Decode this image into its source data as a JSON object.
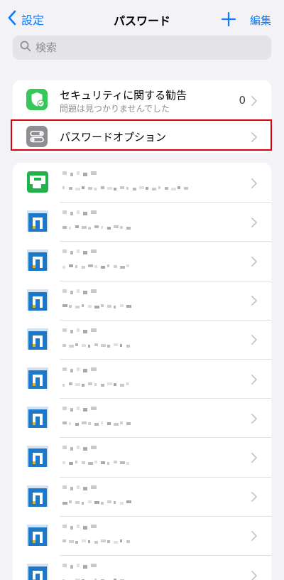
{
  "nav": {
    "back_label": "設定",
    "title": "パスワード",
    "edit_label": "編集"
  },
  "search": {
    "placeholder": "検索"
  },
  "security": {
    "title": "セキュリティに関する勧告",
    "subtitle": "問題は見つかりませんでした",
    "count": "0"
  },
  "options": {
    "title": "パスワードオプション"
  },
  "accounts": [
    {
      "icon": "green-app-icon"
    },
    {
      "icon": "blue-app-icon"
    },
    {
      "icon": "blue-app-icon"
    },
    {
      "icon": "blue-app-icon"
    },
    {
      "icon": "blue-app-icon"
    },
    {
      "icon": "blue-app-icon"
    },
    {
      "icon": "blue-app-icon"
    },
    {
      "icon": "blue-app-icon"
    },
    {
      "icon": "blue-app-icon"
    },
    {
      "icon": "blue-app-icon"
    },
    {
      "icon": "blue-app-icon"
    }
  ],
  "colors": {
    "accent": "#0a7aff",
    "security_green": "#34c759",
    "options_gray": "#8e8e93",
    "highlight_red": "#d9000d",
    "app_blue": "#1e78c8",
    "app_green": "#21b24b"
  }
}
